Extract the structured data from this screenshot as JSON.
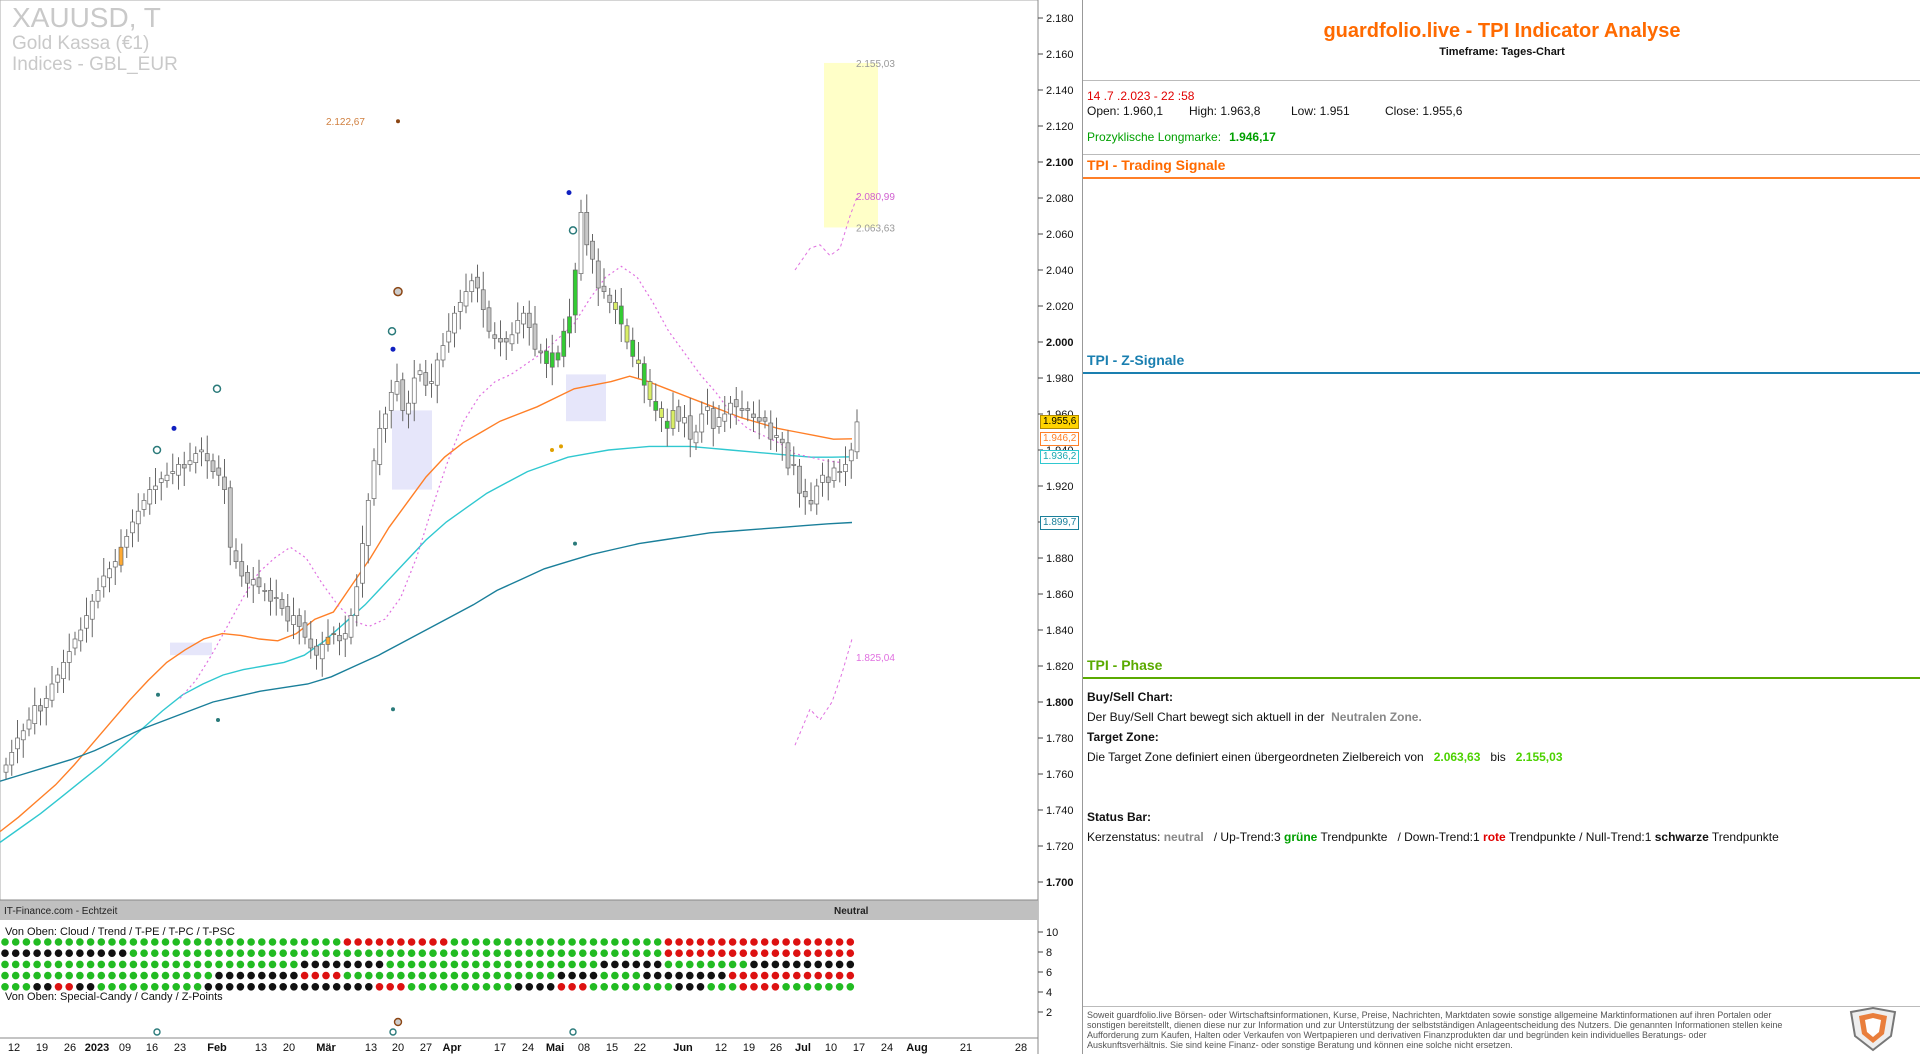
{
  "symbol": {
    "ticker": "XAUUSD, T",
    "name": "Gold Kassa (€1)",
    "exchange": "Indices - GBL_EUR"
  },
  "footer": {
    "source": "IT-Finance.com - Echtzeit",
    "status": "Neutral",
    "cloud_label": "Von Oben: Cloud / Trend / T-PE / T-PC / T-PSC",
    "candy_label": "Von Oben: Special-Candy / Candy / Z-Points"
  },
  "chart_data": {
    "type": "candlestick",
    "y_axis_ticks": [
      "1.700",
      "1.720",
      "1.740",
      "1.760",
      "1.780",
      "1.800",
      "1.820",
      "1.840",
      "1.860",
      "1.880",
      "1.900",
      "1.920",
      "1.940",
      "1.960",
      "1.980",
      "2.000",
      "2.020",
      "2.040",
      "2.060",
      "2.080",
      "2.100",
      "2.120",
      "2.140",
      "2.160",
      "2.180"
    ],
    "y_tick_values": [
      1700,
      1720,
      1740,
      1760,
      1780,
      1800,
      1820,
      1840,
      1860,
      1880,
      1900,
      1920,
      1940,
      1960,
      1980,
      2000,
      2020,
      2040,
      2060,
      2080,
      2100,
      2120,
      2140,
      2160,
      2180
    ],
    "ylim": [
      1690,
      2190
    ],
    "x_axis_labels": [
      "12",
      "19",
      "26",
      "2023",
      "09",
      "16",
      "23",
      "Feb",
      "13",
      "20",
      "Mär",
      "13",
      "20",
      "27",
      "Apr",
      "17",
      "24",
      "Mai",
      "08",
      "15",
      "22",
      "Jun",
      "12",
      "19",
      "26",
      "Jul",
      "10",
      "17",
      "24",
      "Aug",
      "21",
      "28"
    ],
    "close": [
      1765,
      1772,
      1780,
      1784,
      1790,
      1798,
      1795,
      1802,
      1810,
      1815,
      1822,
      1828,
      1835,
      1840,
      1848,
      1856,
      1862,
      1870,
      1874,
      1878,
      1886,
      1892,
      1900,
      1906,
      1912,
      1918,
      1920,
      1924,
      1926,
      1928,
      1932,
      1930,
      1934,
      1938,
      1940,
      1934,
      1928,
      1926,
      1918,
      1886,
      1878,
      1870,
      1866,
      1868,
      1864,
      1862,
      1856,
      1858,
      1852,
      1845,
      1848,
      1842,
      1836,
      1830,
      1826,
      1832,
      1836,
      1838,
      1834,
      1838,
      1848,
      1864,
      1888,
      1912,
      1934,
      1952,
      1960,
      1972,
      1978,
      1962,
      1966,
      1980,
      1984,
      1976,
      1978,
      1990,
      1998,
      2006,
      2016,
      2022,
      2028,
      2034,
      2030,
      2018,
      2006,
      2002,
      2000,
      2000,
      2004,
      2012,
      2016,
      2008,
      1996,
      1994,
      1988,
      1994,
      1990,
      2006,
      2014,
      2040,
      2072,
      2054,
      2046,
      2030,
      2028,
      2022,
      2018,
      2010,
      2000,
      1992,
      1988,
      1976,
      1968,
      1962,
      1958,
      1952,
      1962,
      1956,
      1958,
      1946,
      1950,
      1960,
      1964,
      1952,
      1958,
      1960,
      1966,
      1964,
      1962,
      1962,
      1958,
      1956,
      1956,
      1946,
      1948,
      1944,
      1930,
      1932,
      1916,
      1914,
      1910,
      1920,
      1926,
      1922,
      1930,
      1928,
      1932,
      1940,
      1955.6
    ],
    "candle_colors": {
      "up": "#ffffff",
      "down": "#c8c8c8",
      "signal_green": "#33cc33",
      "signal_yellow": "#d9ee66",
      "signal_orange": "#ffaa33"
    },
    "series": [
      {
        "type": "line",
        "color": "#ff7f27",
        "current": "1.946,2",
        "values": [
          1728,
          1736,
          1745,
          1754,
          1765,
          1777,
          1789,
          1801,
          1812,
          1822,
          1829,
          1835,
          1838,
          1837,
          1835,
          1834,
          1838,
          1846,
          1850,
          1865,
          1880,
          1897,
          1911,
          1925,
          1936,
          1944,
          1950,
          1956,
          1960,
          1964,
          1969,
          1974,
          1976,
          1978,
          1981,
          1978,
          1974,
          1970,
          1966,
          1962,
          1958,
          1955,
          1952,
          1950,
          1948,
          1946,
          1946.2
        ]
      },
      {
        "type": "line",
        "color": "#30c8d0",
        "current": "1.936,2",
        "values": [
          1722,
          1730,
          1738,
          1747,
          1756,
          1765,
          1775,
          1785,
          1795,
          1804,
          1810,
          1815,
          1818,
          1820,
          1822,
          1826,
          1834,
          1844,
          1854,
          1866,
          1878,
          1890,
          1900,
          1908,
          1916,
          1922,
          1928,
          1932,
          1936,
          1938,
          1940,
          1941,
          1942,
          1942,
          1942,
          1941,
          1940,
          1939,
          1938,
          1937,
          1936,
          1936,
          1936.2
        ]
      },
      {
        "type": "line",
        "color": "#1a7f9a",
        "current": "1.899,7",
        "values": [
          1756,
          1760,
          1764,
          1768,
          1773,
          1779,
          1785,
          1790,
          1795,
          1800,
          1803,
          1806,
          1808,
          1810,
          1814,
          1820,
          1826,
          1833,
          1840,
          1847,
          1854,
          1862,
          1868,
          1874,
          1878,
          1882,
          1885,
          1888,
          1890,
          1892,
          1894,
          1895,
          1896,
          1897,
          1898,
          1899,
          1899.7
        ]
      },
      {
        "type": "dotted",
        "color": "#e070e0",
        "values": [
          1802,
          1812,
          1826,
          1842,
          1858,
          1872,
          1880,
          1886,
          1880,
          1866,
          1854,
          1845,
          1842,
          1846,
          1858,
          1880,
          1908,
          1934,
          1956,
          1970,
          1978,
          1982,
          1988,
          1994,
          2002,
          2010,
          2024,
          2036,
          2042,
          2036,
          2022,
          2006,
          1994,
          1982,
          1972,
          1960,
          1952,
          1948,
          1944,
          1938,
          1936,
          1934,
          1933
        ]
      }
    ],
    "price_labels": [
      "1.955,6",
      "1.946,2",
      "1.936,2",
      "1.899,7"
    ],
    "annotations": [
      {
        "text": "2.122,67",
        "price": 2122.67
      },
      {
        "text": "2.155,03",
        "price": 2155.03
      },
      {
        "text": "2.080,99",
        "price": 2080.99
      },
      {
        "text": "2.063,63",
        "price": 2063.63
      },
      {
        "text": "1.825,04",
        "price": 1825.04
      }
    ],
    "status_rows": [
      {
        "segments": [
          [
            "green",
            32
          ],
          [
            "red",
            10
          ],
          [
            "green",
            20
          ],
          [
            "red",
            18
          ]
        ]
      },
      {
        "segments": [
          [
            "black",
            12
          ],
          [
            "green",
            50
          ],
          [
            "red",
            18
          ]
        ]
      },
      {
        "segments": [
          [
            "green",
            28
          ],
          [
            "black",
            8
          ],
          [
            "green",
            20
          ],
          [
            "black",
            6
          ],
          [
            "green",
            8
          ],
          [
            "black",
            10
          ]
        ]
      },
      {
        "segments": [
          [
            "green",
            20
          ],
          [
            "black",
            8
          ],
          [
            "red",
            4
          ],
          [
            "green",
            20
          ],
          [
            "black",
            4
          ],
          [
            "green",
            4
          ],
          [
            "black",
            8
          ],
          [
            "red",
            12
          ]
        ]
      },
      {
        "segments": [
          [
            "green",
            3
          ],
          [
            "black",
            2
          ],
          [
            "red",
            2
          ],
          [
            "black",
            2
          ],
          [
            "green",
            10
          ],
          [
            "black",
            16
          ],
          [
            "red",
            3
          ],
          [
            "green",
            10
          ],
          [
            "black",
            4
          ],
          [
            "red",
            3
          ],
          [
            "green",
            8
          ],
          [
            "black",
            3
          ],
          [
            "green",
            3
          ],
          [
            "red",
            4
          ],
          [
            "green",
            7
          ]
        ]
      }
    ]
  },
  "analysis": {
    "title": "guardfolio.live - TPI Indicator Analyse",
    "timeframe": "Timeframe: Tages-Chart",
    "datetime": "14 .7 .2.023  - 22 :58",
    "ohlc": {
      "open": "Open:  1.960,1",
      "high": "High:  1.963,8",
      "low": "Low:      1.951",
      "close": "Close:  1.955,6"
    },
    "longmarke_label": "Prozyklische Longmarke:",
    "longmarke_value": "1.946,17",
    "section_trading": "TPI - Trading Signale",
    "section_z": "TPI - Z-Signale",
    "section_phase": "TPI - Phase",
    "buy_sell_title": "Buy/Sell Chart:",
    "buy_sell_text": "Der Buy/Sell Chart bewegt sich aktuell in der",
    "buy_sell_zone": "Neutralen Zone.",
    "target_title": "Target Zone:",
    "target_text": "Die Target Zone definiert einen übergeordneten Zielbereich von",
    "target_from": "2.063,63",
    "target_bis": "bis",
    "target_to": "2.155,03",
    "status_title": "Status Bar:",
    "status_parts": [
      "Kerzenstatus:",
      "neutral",
      "/ Up-Trend:3",
      "grüne",
      "Trendpunkte",
      "/ Down-Trend:1",
      "rote",
      "Trendpunkte",
      "/ Null-Trend:1",
      "schwarze",
      "Trendpunkte"
    ],
    "disclaimer": "Soweit guardfolio.live Börsen- oder Wirtschaftsinformationen, Kurse, Preise, Nachrichten, Marktdaten sowie sonstige allgemeine Marktinformationen auf ihren Portalen oder sonstigen bereitstellt, dienen diese nur zur Information und zur Unterstützung der selbstständigen Anlageentscheidung des Nutzers. Die genannten Informationen stellen keine Aufforderung zum Kaufen, Halten oder Verkaufen von Wertpapieren und derivativen Finanzprodukten dar und begründen kein individuelles Beratungs- oder Auskunftsverhältnis. Sie sind keine Finanz- oder sonstige Beratung und können eine solche nicht ersetzen."
  }
}
